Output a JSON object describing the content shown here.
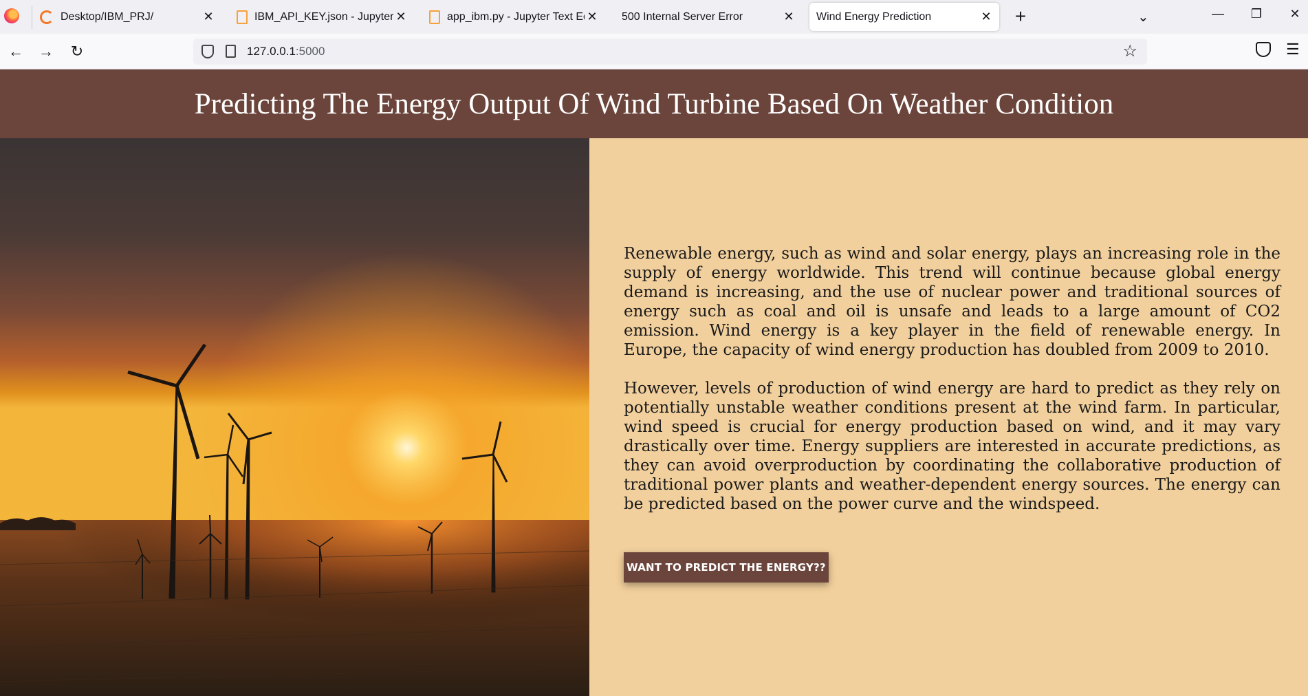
{
  "browser": {
    "tabs": [
      {
        "label": "Desktop/IBM_PRJ/",
        "icon": "jupyter-icon"
      },
      {
        "label": "IBM_API_KEY.json - Jupyter Text",
        "icon": "file-icon"
      },
      {
        "label": "app_ibm.py - Jupyter Text Editor",
        "icon": "file-icon"
      },
      {
        "label": "500 Internal Server Error",
        "icon": ""
      },
      {
        "label": "Wind Energy Prediction",
        "icon": "",
        "active": true
      }
    ],
    "url": {
      "host": "127.0.0.1",
      "port": ":5000"
    }
  },
  "page": {
    "title": "Predicting The Energy Output Of Wind Turbine Based On Weather Condition",
    "paragraph_1": "Renewable energy, such as wind and solar energy, plays an increasing role in the supply of energy worldwide. This trend will continue because global energy demand is increasing, and the use of nuclear power and traditional sources of energy such as coal and oil is unsafe and leads to a large amount of CO2 emission. Wind energy is a key player in the field of renewable energy. In Europe, the capacity of wind energy production has doubled from 2009 to 2010.",
    "paragraph_2": "However, levels of production of wind energy are hard to predict as they rely on potentially unstable weather conditions present at the wind farm. In particular, wind speed is crucial for energy production based on wind, and it may vary drastically over time. Energy suppliers are interested in accurate predictions, as they can avoid overproduction by coordinating the collaborative production of traditional power plants and weather-dependent energy sources. The energy can be predicted based on the power curve and the windspeed.",
    "cta_label": "WANT TO PREDICT THE ENERGY??"
  },
  "colors": {
    "header_bg": "#6b453b",
    "text_pane_bg": "#f2d09d",
    "button_bg": "#6b453b"
  }
}
